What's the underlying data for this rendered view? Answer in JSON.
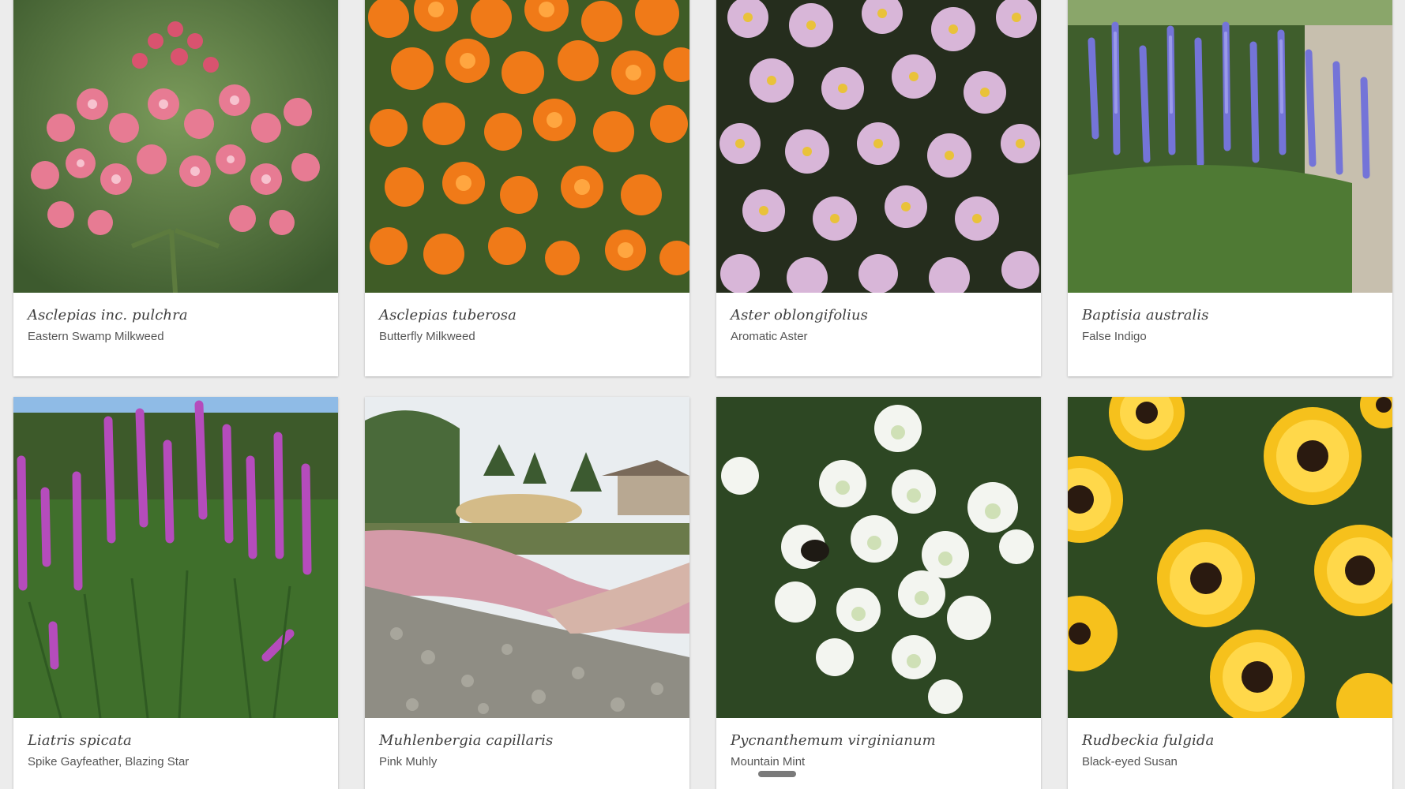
{
  "plants": [
    {
      "scientific": "Asclepias inc. pulchra",
      "common": "Eastern Swamp Milkweed",
      "photo_icon": "pink-milkweed-flowers-photo",
      "palette": [
        "#4a6b3a",
        "#e26b86",
        "#c94a6a",
        "#f2a0b6"
      ]
    },
    {
      "scientific": "Asclepias tuberosa",
      "common": "Butterfly Milkweed",
      "photo_icon": "orange-milkweed-flowers-photo",
      "palette": [
        "#3e5a26",
        "#f07b1a",
        "#e8601a",
        "#ffa23a"
      ]
    },
    {
      "scientific": "Aster oblongifolius",
      "common": "Aromatic Aster",
      "photo_icon": "lavender-aster-flowers-photo",
      "palette": [
        "#2a3320",
        "#d9b5d8",
        "#c596c8",
        "#f1d6ec"
      ]
    },
    {
      "scientific": "Baptisia australis",
      "common": "False Indigo",
      "photo_icon": "blue-indigo-flowers-photo",
      "palette": [
        "#40602e",
        "#6f6fd6",
        "#8585e0",
        "#c9c3b5"
      ]
    },
    {
      "scientific": "Liatris spicata",
      "common": "Spike Gayfeather, Blazing Star",
      "photo_icon": "purple-liatris-spikes-photo",
      "palette": [
        "#3e6a2e",
        "#b04ab8",
        "#d063c8",
        "#88b6e6"
      ]
    },
    {
      "scientific": "Muhlenbergia capillaris",
      "common": "Pink Muhly",
      "photo_icon": "pink-muhly-grass-landscape-photo",
      "palette": [
        "#8a8a80",
        "#d49aa8",
        "#b0a58a",
        "#e8ecef"
      ]
    },
    {
      "scientific": "Pycnanthemum virginianum",
      "common": "Mountain Mint",
      "photo_icon": "white-mountain-mint-flowers-photo",
      "palette": [
        "#2f4a24",
        "#f4f6f2",
        "#cfe0b8",
        "#3c5c2c"
      ]
    },
    {
      "scientific": "Rudbeckia fulgida",
      "common": "Black-eyed Susan",
      "photo_icon": "yellow-black-eyed-susan-photo",
      "palette": [
        "#2e4a22",
        "#f6c21c",
        "#ffd63a",
        "#2b1a10"
      ]
    }
  ]
}
